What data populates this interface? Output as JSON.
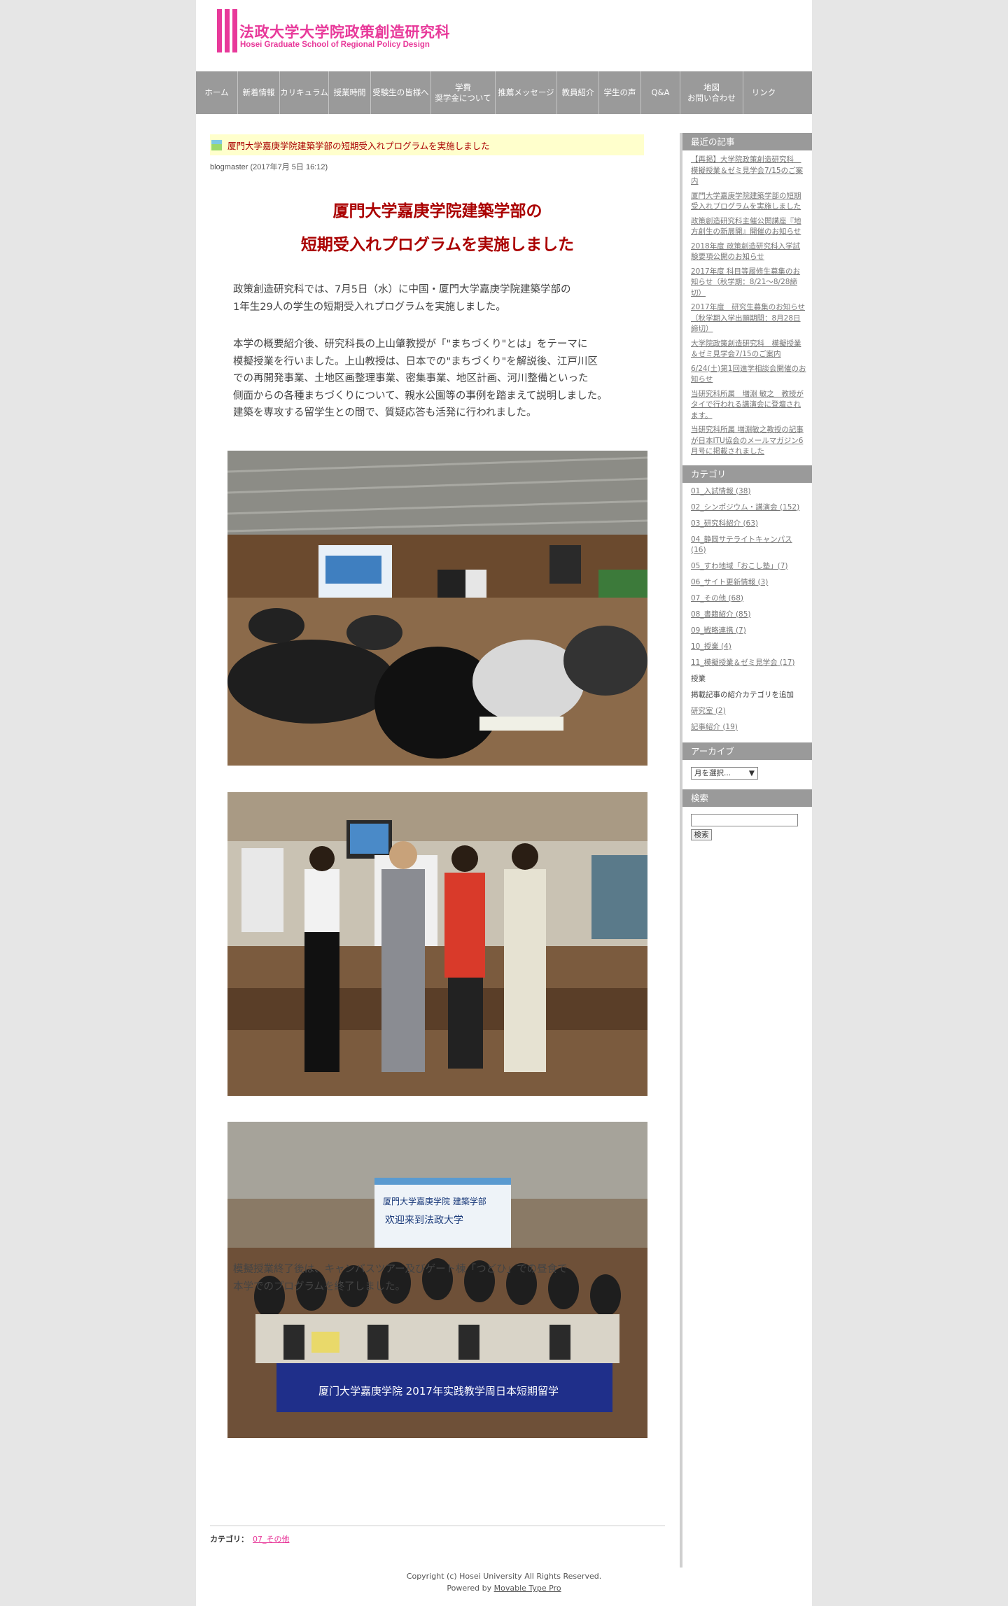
{
  "header": {
    "title": "法政大学大学院政策創造研究科",
    "subtitle": "Hosei Graduate School  of Regional Policy Design"
  },
  "nav": [
    {
      "label": "ホーム",
      "width": 60
    },
    {
      "label": "新着情報",
      "width": 60
    },
    {
      "label": "カリキュラム",
      "width": 70
    },
    {
      "label": "授業時間",
      "width": 60
    },
    {
      "label": "受験生の皆様へ",
      "width": 86
    },
    {
      "label": "学費\n奨学金について",
      "width": 92
    },
    {
      "label": "推薦メッセージ",
      "width": 88
    },
    {
      "label": "教員紹介",
      "width": 60
    },
    {
      "label": "学生の声",
      "width": 60
    },
    {
      "label": "Q&A",
      "width": 56
    },
    {
      "label": "地図\nお問い合わせ",
      "width": 90
    },
    {
      "label": "リンク",
      "width": 58
    }
  ],
  "post": {
    "title_small": "厦門大学嘉庚学院建築学部の短期受入れプログラムを実施しました",
    "meta": "blogmaster (2017年7月 5日 16:12)",
    "headline_1": "厦門大学嘉庚学院建築学部の",
    "headline_2": "短期受入れプログラムを実施しました",
    "p1": "政策創造研究科では、7月5日（水）に中国・厦門大学嘉庚学院建築学部の\n1年生29人の学生の短期受入れプログラムを実施しました。",
    "p2": "本学の概要紹介後、研究科長の上山肇教授が「\"まちづくり\"とは」をテーマに\n模擬授業を行いました。上山教授は、日本での\"まちづくり\"を解説後、江戸川区\nでの再開発事業、土地区画整理事業、密集事業、地区計画、河川整備といった\n側面からの各種まちづくりについて、親水公園等の事例を踏まえて説明しました。\n建築を専攻する留学生との間で、質疑応答も活発に行われました。",
    "p3": "模擬授業終了後は、キャンパスツアー及びゲート棟「つどひ」での昼食で\n本学でのプログラムを終了しました。",
    "photo3_banner": "厦门大学嘉庚学院 2017年实践教学周日本短期留学",
    "photo3_screen_1": "厦門大学嘉庚学院  建築学部",
    "photo3_screen_2": "欢迎来到法政大学",
    "category_label": "カテゴリ：",
    "category_value": "07_その他"
  },
  "sidebar": {
    "recent_heading": "最近の記事",
    "recent": [
      "【再掲】大学院政策創造研究科　模擬授業＆ゼミ見学会7/15のご案内",
      "厦門大学嘉庚学院建築学部の短期受入れプログラムを実施しました",
      "政策創造研究科主催公開講座『地方創生の新展開』開催のお知らせ",
      "2018年度 政策創造研究科入学試験要項公開のお知らせ",
      "2017年度 科目等履修生募集のお知らせ（秋学期：8/21〜8/28締切）",
      "2017年度　研究生募集のお知らせ（秋学期入学出願期間：8月28日締切）",
      "大学院政策創造研究科　模擬授業＆ゼミ見学会7/15のご案内",
      "6/24(土)第1回進学相談会開催のお知らせ",
      "当研究科所属　増淵 敏之　教授がタイで行われる講演会に登壇されます。",
      "当研究科所属 増淵敏之教授の記事が日本ITU協会のメールマガジン6月号に掲載されました"
    ],
    "category_heading": "カテゴリ",
    "categories": [
      {
        "label": "01_入試情報 (38)",
        "link": true
      },
      {
        "label": "02_シンポジウム・講演会 (152)",
        "link": true
      },
      {
        "label": "03_研究科紹介 (63)",
        "link": true
      },
      {
        "label": "04_静岡サテライトキャンパス (16)",
        "link": true
      },
      {
        "label": "05_すわ地域「おこし塾」(7)",
        "link": true
      },
      {
        "label": "06_サイト更新情報 (3)",
        "link": true
      },
      {
        "label": "07_その他 (68)",
        "link": true
      },
      {
        "label": "08_書籍紹介 (85)",
        "link": true
      },
      {
        "label": "09_戦略連携 (7)",
        "link": true
      },
      {
        "label": "10_授業 (4)",
        "link": true
      },
      {
        "label": "11_模擬授業＆ゼミ見学会 (17)",
        "link": true
      },
      {
        "label": "授業",
        "link": false
      },
      {
        "label": "掲載記事の紹介カテゴリを追加",
        "link": false
      },
      {
        "label": "研究室 (2)",
        "link": true
      },
      {
        "label": "記事紹介 (19)",
        "link": true
      }
    ],
    "archive_heading": "アーカイブ",
    "archive_select": "月を選択...",
    "search_heading": "検索",
    "search_button": "検索"
  },
  "footer": {
    "copyright": "Copyright (c) Hosei University All Rights Reserved.",
    "powered_by": "Powered by",
    "powered_link": "Movable Type Pro"
  },
  "colors": {
    "brand_pink": "#e8399a",
    "headline_red": "#aa0000",
    "nav_gray": "#9a9a9a"
  }
}
